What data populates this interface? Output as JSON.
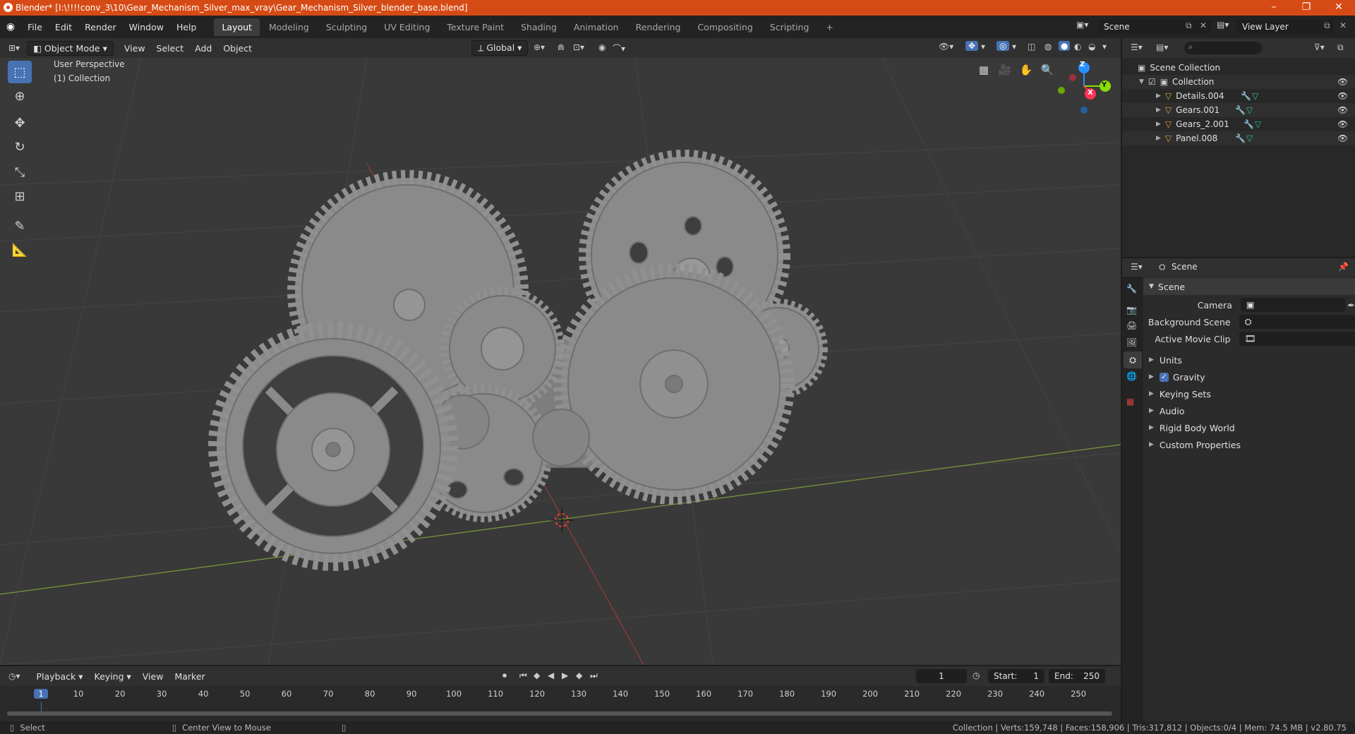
{
  "window": {
    "title": "Blender* [I:\\!!!!conv_3\\10\\Gear_Mechanism_Silver_max_vray\\Gear_Mechanism_Silver_blender_base.blend]",
    "minimize": "–",
    "restore": "❐",
    "close": "✕"
  },
  "menubar": {
    "menus": [
      "File",
      "Edit",
      "Render",
      "Window",
      "Help"
    ],
    "workspaces": [
      "Layout",
      "Modeling",
      "Sculpting",
      "UV Editing",
      "Texture Paint",
      "Shading",
      "Animation",
      "Rendering",
      "Compositing",
      "Scripting"
    ],
    "add_tab": "+",
    "scene_name": "Scene",
    "view_layer": "View Layer"
  },
  "viewport_header": {
    "mode": "Object Mode",
    "menus": [
      "View",
      "Select",
      "Add",
      "Object"
    ],
    "orientation": "Global"
  },
  "viewport": {
    "perspective": "User Perspective",
    "collection": "(1) Collection",
    "gizmo_axes": {
      "z": "Z",
      "y": "Y",
      "x": "X"
    }
  },
  "toolbar": {
    "tools": [
      "select-box-tool",
      "cursor-tool",
      "move-tool",
      "rotate-tool",
      "scale-tool",
      "transform-tool",
      "annotate-tool",
      "measure-tool"
    ]
  },
  "outliner": {
    "search_placeholder": "",
    "root": "Scene Collection",
    "collection": "Collection",
    "objects": [
      "Details.004",
      "Gears.001",
      "Gears_2.001",
      "Panel.008"
    ]
  },
  "properties": {
    "context": "Scene",
    "section": "Scene",
    "fields": [
      {
        "label": "Camera",
        "value": ""
      },
      {
        "label": "Background Scene",
        "value": ""
      },
      {
        "label": "Active Movie Clip",
        "value": ""
      }
    ],
    "panels": [
      "Units",
      "Gravity",
      "Keying Sets",
      "Audio",
      "Rigid Body World",
      "Custom Properties"
    ],
    "gravity_checked": true
  },
  "timeline": {
    "menus": [
      "Playback",
      "Keying",
      "View",
      "Marker"
    ],
    "current_frame": "1",
    "start_label": "Start:",
    "start": "1",
    "end_label": "End:",
    "end": "250",
    "ticks": [
      "1",
      "10",
      "20",
      "30",
      "40",
      "50",
      "60",
      "70",
      "80",
      "90",
      "100",
      "110",
      "120",
      "130",
      "140",
      "150",
      "160",
      "170",
      "180",
      "190",
      "200",
      "210",
      "220",
      "230",
      "240",
      "250"
    ]
  },
  "statusbar": {
    "left_action": "Select",
    "mid_action": "Center View to Mouse",
    "stats": "Collection | Verts:159,748 | Faces:158,906 | Tris:317,812 | Objects:0/4 | Mem: 74.5 MB | v2.80.75"
  },
  "colors": {
    "titlebar": "#d64b15",
    "accent": "#4772b3",
    "x_axis": "#ff3352",
    "y_axis": "#8bdc00",
    "z_axis": "#2890ff",
    "object_icon": "#e8a23a",
    "mesh_icon": "#30c0a0"
  }
}
